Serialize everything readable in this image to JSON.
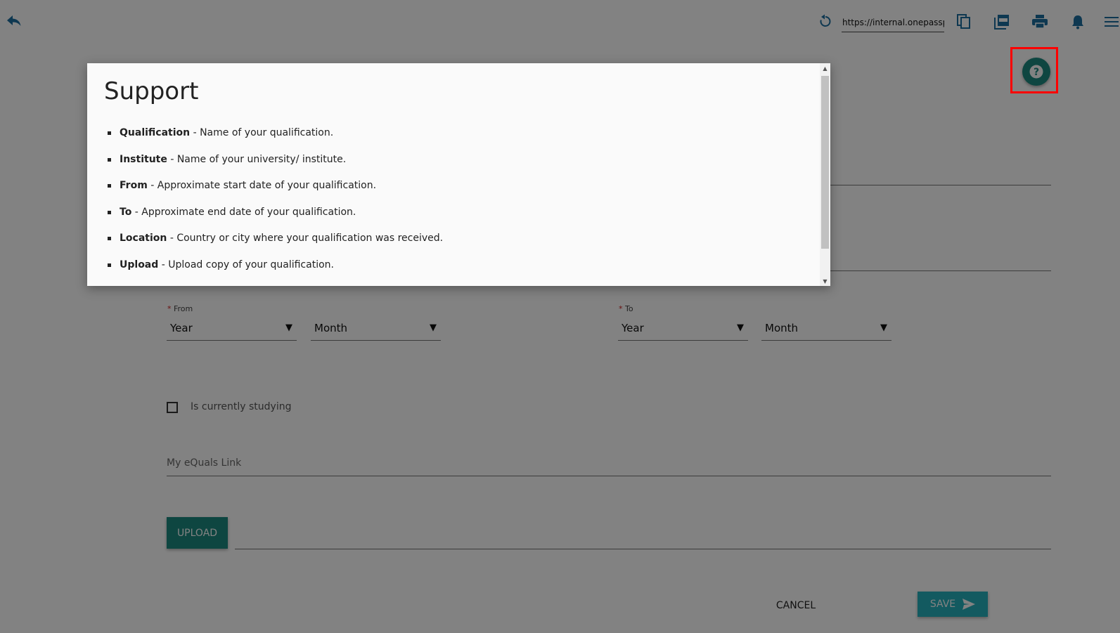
{
  "topbar": {
    "url": "https://internal.onepassport",
    "icons": [
      "back-arrow-icon",
      "refresh-icon",
      "copy-icon",
      "pdf-icon",
      "print-icon",
      "bell-icon",
      "menu-icon"
    ]
  },
  "help_button": {
    "icon": "question-mark-icon",
    "color": "#1c8a80"
  },
  "form": {
    "from_label": "From",
    "to_label": "To",
    "required_mark": "*",
    "from_year": "Year",
    "from_month": "Month",
    "to_year": "Year",
    "to_month": "Month",
    "currently_studying_label": "Is currently studying",
    "equals_placeholder": "My eQuals Link",
    "upload_label": "UPLOAD",
    "cancel_label": "CANCEL",
    "save_label": "SAVE"
  },
  "modal": {
    "title": "Support",
    "items": [
      {
        "term": "Qualification",
        "desc": "- Name of your qualification."
      },
      {
        "term": "Institute",
        "desc": "- Name of your university/ institute."
      },
      {
        "term": "From",
        "desc": "- Approximate start date of your qualification."
      },
      {
        "term": "To",
        "desc": "- Approximate end date of your qualification."
      },
      {
        "term": "Location",
        "desc": "- Country or city where your qualification was received."
      },
      {
        "term": "Upload",
        "desc": "- Upload copy of your qualification."
      }
    ]
  },
  "colors": {
    "accent": "#1c8a80",
    "save": "#27b0bd",
    "highlight": "#ff0000"
  }
}
